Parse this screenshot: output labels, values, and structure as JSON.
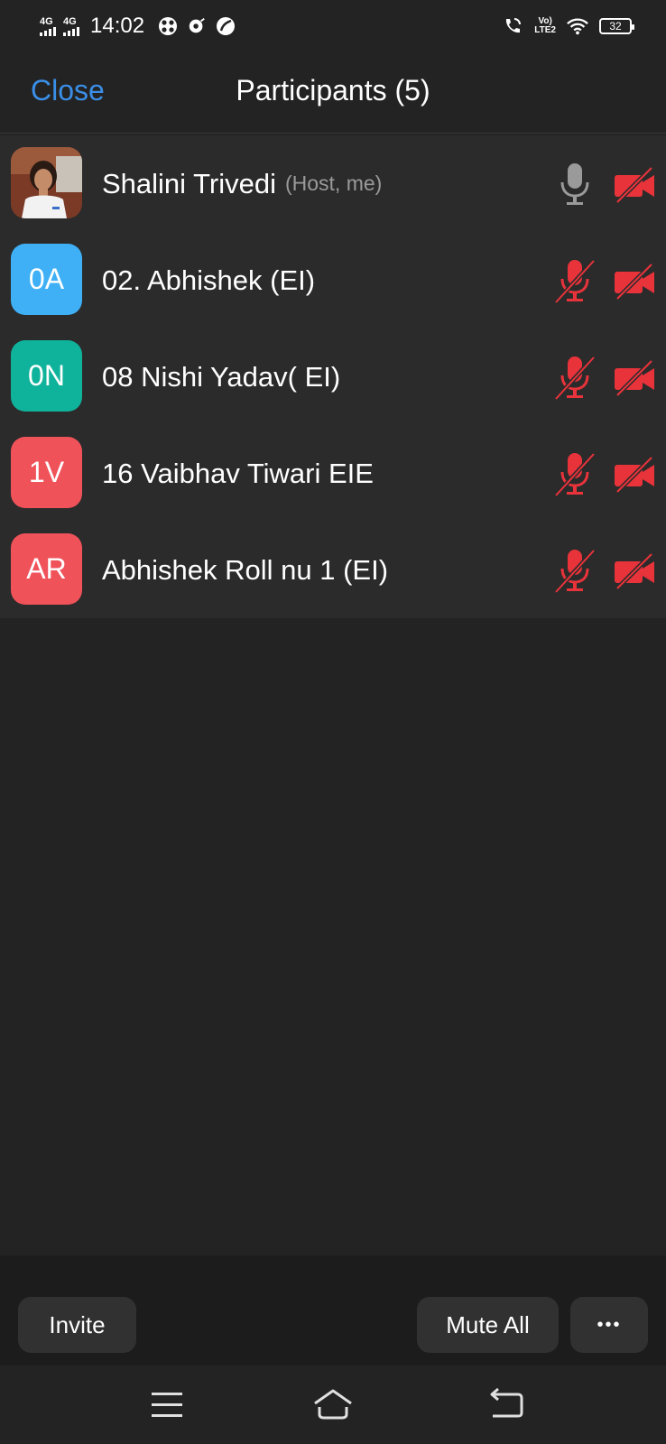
{
  "status_bar": {
    "sim1": "4G",
    "sim2": "4G",
    "time": "14:02",
    "volte_line1": "Vo)",
    "volte_line2": "LTE2",
    "battery": "32"
  },
  "header": {
    "close_label": "Close",
    "title": "Participants (5)"
  },
  "participants": [
    {
      "initials": "",
      "name": "Shalini Trivedi",
      "role": "(Host, me)",
      "avatar": "photo",
      "color": "#6b3b2a",
      "mic": "on",
      "camera": "off"
    },
    {
      "initials": "0A",
      "name": "02. Abhishek (EI)",
      "role": "",
      "avatar": "initials",
      "color": "#3fb0f5",
      "mic": "muted",
      "camera": "off"
    },
    {
      "initials": "0N",
      "name": "08 Nishi Yadav( EI)",
      "role": "",
      "avatar": "initials",
      "color": "#0fb39b",
      "mic": "muted",
      "camera": "off"
    },
    {
      "initials": "1V",
      "name": "16 Vaibhav Tiwari EIE",
      "role": "",
      "avatar": "initials",
      "color": "#f0525a",
      "mic": "muted",
      "camera": "off"
    },
    {
      "initials": "AR",
      "name": "Abhishek Roll nu 1 (EI)",
      "role": "",
      "avatar": "initials",
      "color": "#f0525a",
      "mic": "muted",
      "camera": "off"
    }
  ],
  "actions": {
    "invite": "Invite",
    "mute_all": "Mute All",
    "more": "•••"
  },
  "colors": {
    "accent": "#3a8ee6",
    "muted_red": "#e8333b",
    "mic_on_gray": "#9a9a9a"
  },
  "icons": [
    "menu-icon",
    "home-icon",
    "back-icon"
  ]
}
